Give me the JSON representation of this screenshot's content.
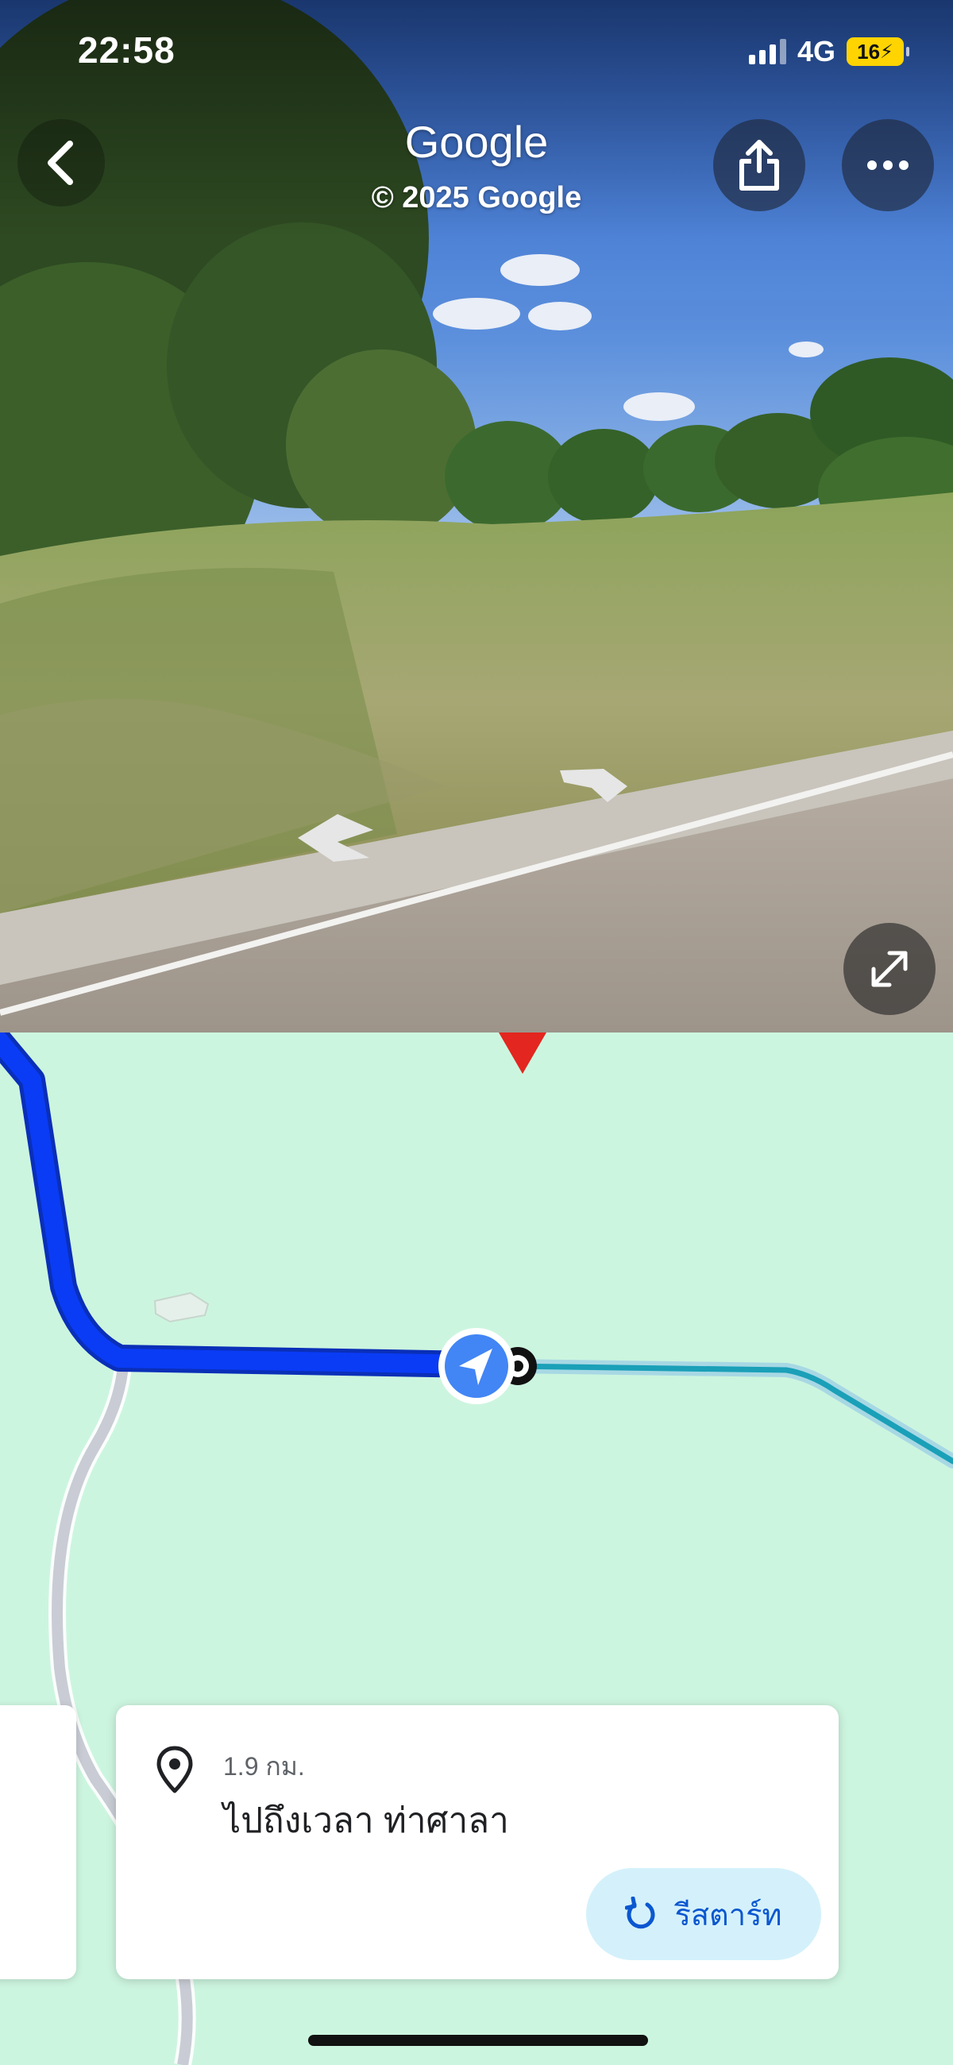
{
  "status_bar": {
    "time": "22:58",
    "network": "4G",
    "battery": "16"
  },
  "street_view": {
    "title": "Google",
    "copyright": "© 2025 Google",
    "back_icon": "chevron-left-icon",
    "share_icon": "share-icon",
    "more_icon": "more-horizontal-icon",
    "expand_icon": "expand-arrows-icon"
  },
  "route_card": {
    "distance": "1.9 กม.",
    "destination": "ไปถึงเวลา ท่าศาลา",
    "restart_label": "รีสตาร์ท",
    "pin_icon": "location-pin-icon",
    "restart_icon": "restart-icon"
  },
  "colors": {
    "map_background": "#ccf5df",
    "route_primary": "#0a3cf5",
    "route_secondary": "#1aa0b8",
    "position_marker": "#4285f4",
    "restart_button_bg": "#d4f1fb"
  }
}
